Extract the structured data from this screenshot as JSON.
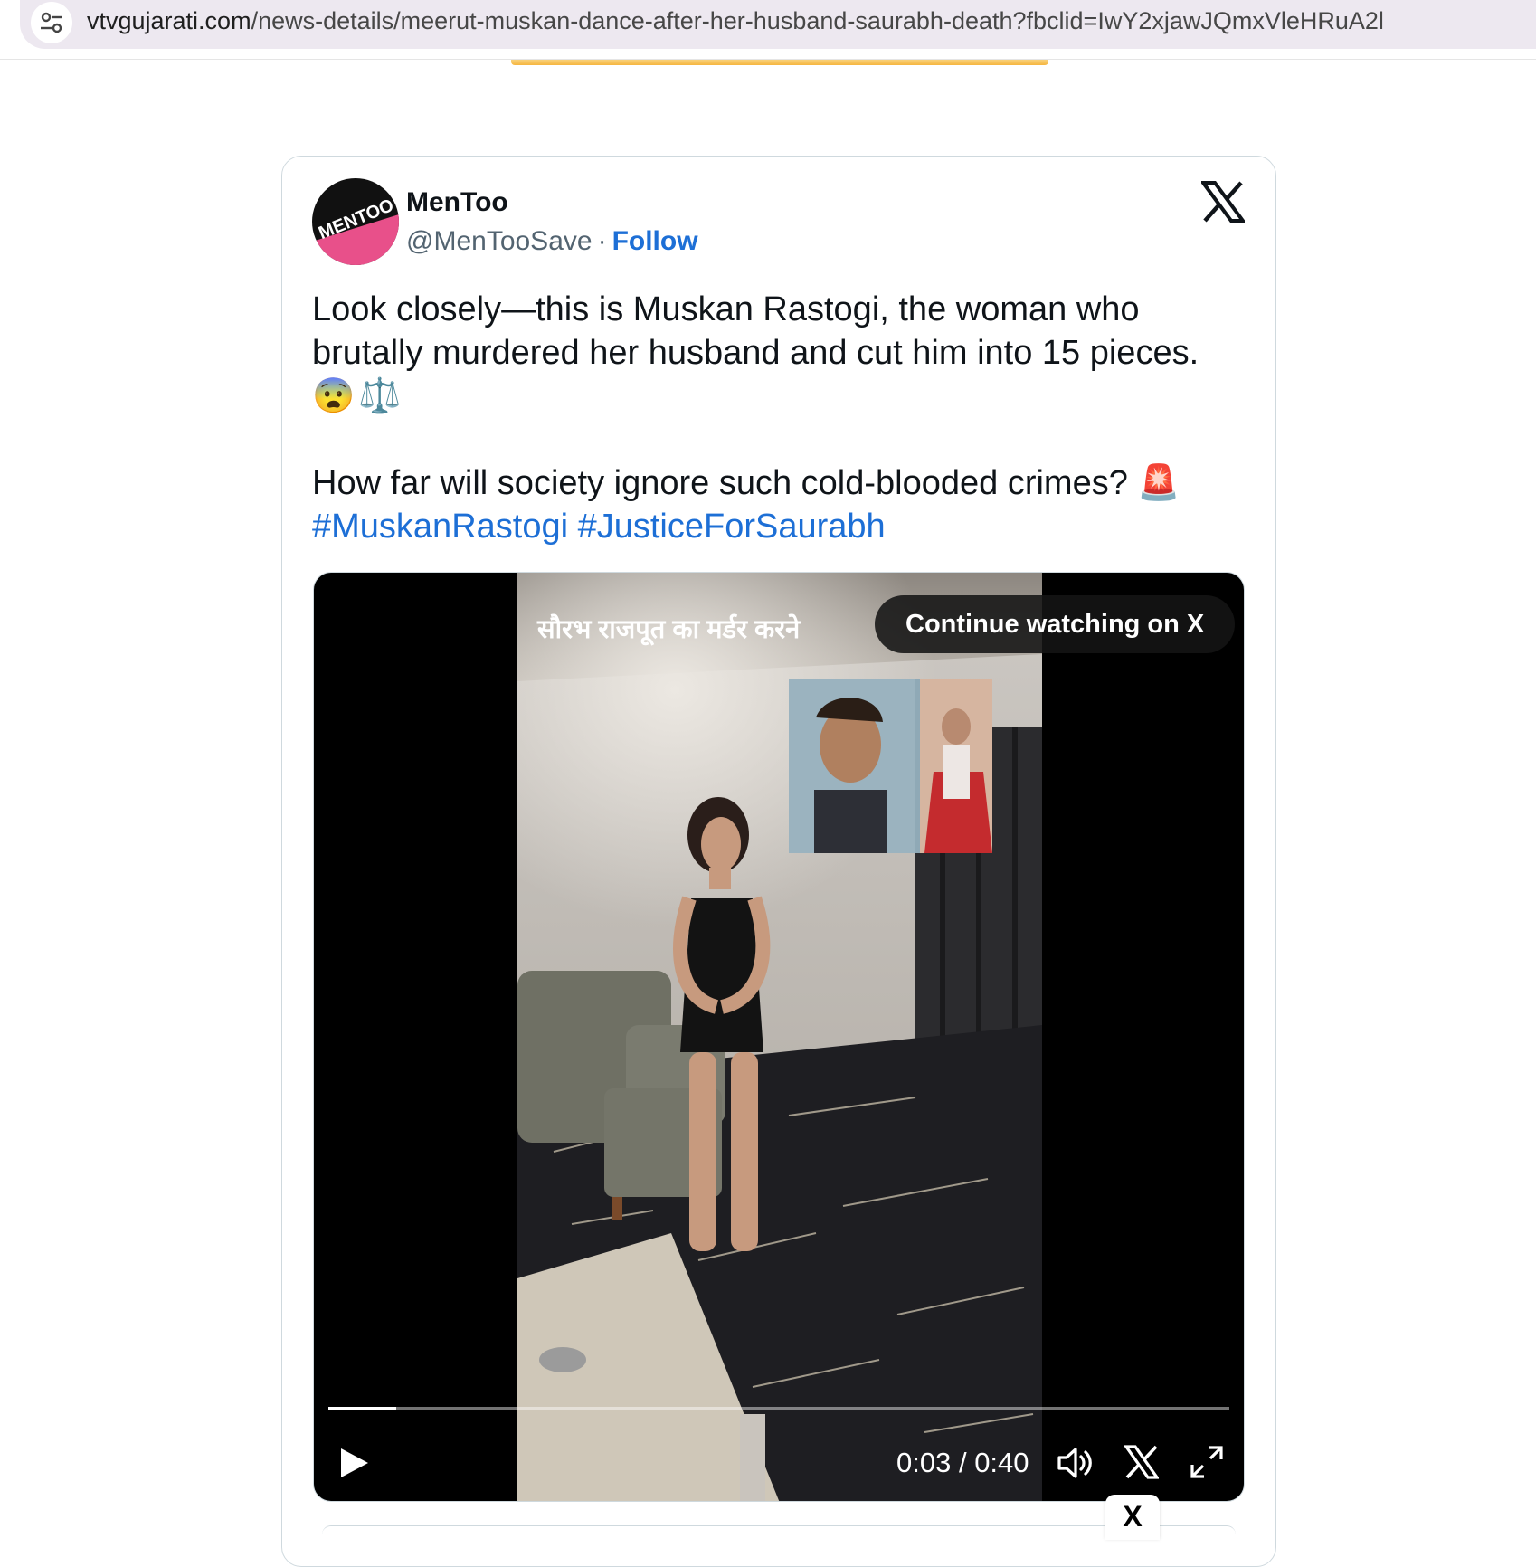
{
  "browser": {
    "url_domain": "vtvgujarati.com",
    "url_path": "/news-details/meerut-muskan-dance-after-her-husband-saurabh-death?fbclid=IwY2xjawJQmxVleHRuA2l",
    "site_info_icon": "tune-icon"
  },
  "tweet": {
    "author_name": "MenToo",
    "handle": "@MenTooSave",
    "separator": "·",
    "follow_label": "Follow",
    "avatar_text": "MENTOO",
    "text_line1": "Look closely—this is Muskan Rastogi, the woman who brutally murdered her husband and cut him into 15 pieces.",
    "emoji1": "😨",
    "emoji2": "⚖️",
    "text_line2": "How far will society ignore such cold-blooded crimes?",
    "emoji3": "🚨",
    "hashtag1": "#MuskanRastogi",
    "hashtag2": "#JusticeForSaurabh"
  },
  "video": {
    "overlay_caption": "सौरभ राजपूत का मर्डर करने",
    "continue_label": "Continue watching on X",
    "current_time": "0:03",
    "time_separator": " / ",
    "duration": "0:40",
    "progress_fraction": 0.075
  },
  "footer": {
    "x_tab_label": "X"
  },
  "colors": {
    "link_blue": "#1d6fd6",
    "text_dark": "#0f1419",
    "text_muted": "#536471",
    "border": "#cfd9de",
    "url_bar_bg": "#ede8f0",
    "accent_pink": "#e8508a"
  }
}
